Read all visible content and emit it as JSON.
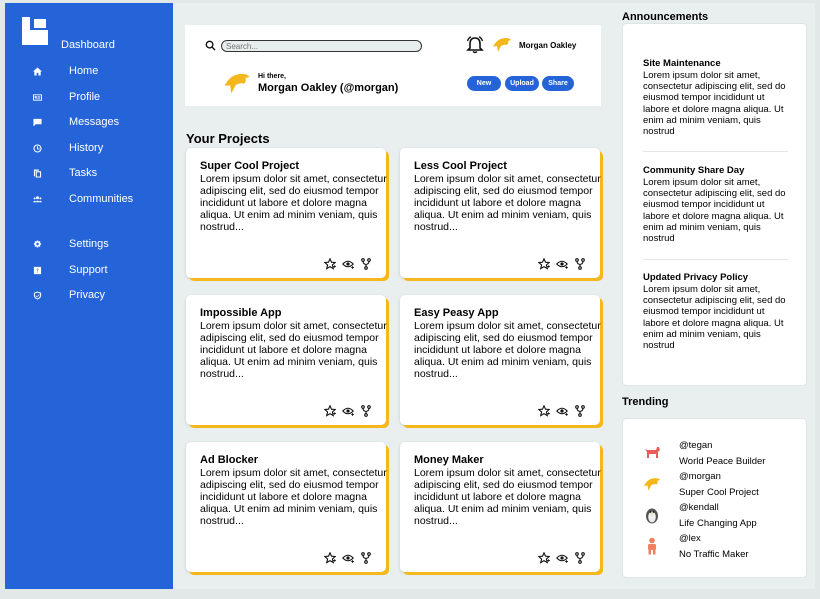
{
  "sidebar": {
    "dashboard_label": "Dashboard",
    "items": [
      {
        "label": "Home",
        "icon": "home-icon"
      },
      {
        "label": "Profile",
        "icon": "id-card-icon"
      },
      {
        "label": "Messages",
        "icon": "message-icon"
      },
      {
        "label": "History",
        "icon": "clock-icon"
      },
      {
        "label": "Tasks",
        "icon": "copy-icon"
      },
      {
        "label": "Communities",
        "icon": "group-icon"
      },
      {
        "label": "Settings",
        "icon": "gear-icon"
      },
      {
        "label": "Support",
        "icon": "help-icon"
      },
      {
        "label": "Privacy",
        "icon": "shield-icon"
      }
    ]
  },
  "header": {
    "search_placeholder": "Search...",
    "username": "Morgan Oakley",
    "greeting_hi": "Hi there,",
    "greeting_name": "Morgan Oakley (@morgan)",
    "buttons": {
      "new": "New",
      "upload": "Upload",
      "share": "Share"
    }
  },
  "projects": {
    "title": "Your Projects",
    "items": [
      {
        "title": "Super Cool Project",
        "desc": "Lorem ipsum dolor sit amet, consectetur adipiscing elit, sed do eiusmod tempor incididunt ut labore et dolore magna aliqua. Ut enim ad minim veniam, quis nostrud..."
      },
      {
        "title": "Less Cool Project",
        "desc": "Lorem ipsum dolor sit amet, consectetur adipiscing elit, sed do eiusmod tempor incididunt ut labore et dolore magna aliqua. Ut enim ad minim veniam, quis nostrud..."
      },
      {
        "title": "Impossible App",
        "desc": "Lorem ipsum dolor sit amet, consectetur adipiscing elit, sed do eiusmod tempor incididunt ut labore et dolore magna aliqua. Ut enim ad minim veniam, quis nostrud..."
      },
      {
        "title": "Easy Peasy App",
        "desc": "Lorem ipsum dolor sit amet, consectetur adipiscing elit, sed do eiusmod tempor incididunt ut labore et dolore magna aliqua. Ut enim ad minim veniam, quis nostrud..."
      },
      {
        "title": "Ad Blocker",
        "desc": "Lorem ipsum dolor sit amet, consectetur adipiscing elit, sed do eiusmod tempor incididunt ut labore et dolore magna aliqua. Ut enim ad minim veniam, quis nostrud..."
      },
      {
        "title": "Money Maker",
        "desc": "Lorem ipsum dolor sit amet, consectetur adipiscing elit, sed do eiusmod tempor incididunt ut labore et dolore magna aliqua. Ut enim ad minim veniam, quis nostrud..."
      }
    ]
  },
  "announcements": {
    "title": "Announcements",
    "items": [
      {
        "title": "Site Maintenance",
        "body": "Lorem ipsum dolor sit amet, consectetur adipiscing elit, sed do eiusmod tempor incididunt ut labore et dolore magna aliqua. Ut enim ad minim veniam, quis nostrud"
      },
      {
        "title": "Community Share Day",
        "body": "Lorem ipsum dolor sit amet, consectetur adipiscing elit, sed do eiusmod tempor incididunt ut labore et dolore magna aliqua. Ut enim ad minim veniam, quis nostrud"
      },
      {
        "title": "Updated Privacy Policy",
        "body": "Lorem ipsum dolor sit amet, consectetur adipiscing elit, sed do eiusmod tempor incididunt ut labore et dolore magna aliqua. Ut enim ad minim veniam, quis nostrud"
      }
    ]
  },
  "trending": {
    "title": "Trending",
    "items": [
      {
        "handle": "@tegan",
        "project": "World Peace Builder",
        "icon": "dog-icon"
      },
      {
        "handle": "@morgan",
        "project": "Super Cool Project",
        "icon": "dolphin-icon"
      },
      {
        "handle": "@kendall",
        "project": "Life Changing App",
        "icon": "penguin-icon"
      },
      {
        "handle": "@lex",
        "project": "No Traffic Maker",
        "icon": "person-icon"
      }
    ]
  },
  "colors": {
    "primary": "#2563d8",
    "accent": "#f5b81c",
    "background": "#e9efef"
  }
}
